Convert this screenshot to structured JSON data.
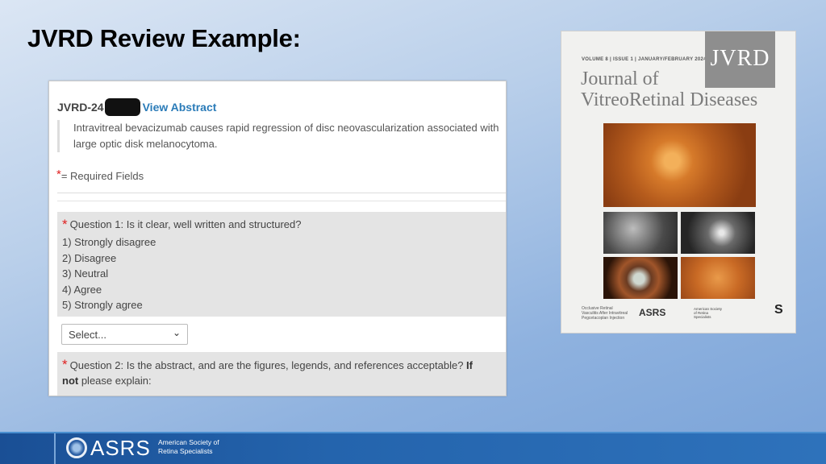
{
  "slide": {
    "title": "JVRD Review Example:"
  },
  "review_form": {
    "manuscript_id_prefix": "JVRD-24",
    "view_abstract_label": "View Abstract",
    "abstract_text": "Intravitreal bevacizumab causes rapid regression of disc neovascularization associated with large optic disk melanocytoma.",
    "required_star": "*",
    "required_label": "= Required Fields",
    "question1": {
      "star": "*",
      "text": "Question 1: Is it clear, well written and structured?",
      "options": [
        "1) Strongly disagree",
        "2) Disagree",
        "3) Neutral",
        "4) Agree",
        "5) Strongly agree"
      ]
    },
    "select_value": "Select...",
    "question2": {
      "star": "*",
      "text": "Question 2: Is the abstract, and are the figures, legends, and references acceptable? ",
      "bold_if": "If",
      "bold_not": "not",
      "tail": " please explain:"
    }
  },
  "journal_cover": {
    "issue_line": "VOLUME 8  |  ISSUE 1  |  JANUARY/FEBRUARY 2024",
    "badge": "JVRD",
    "name_line1": "Journal of",
    "name_line2": "VitreoRetinal Diseases",
    "footer_text": "Occlusive Retinal Vasculitis After Intravitreal Pegcetacoplan Injection",
    "footer_logo": "ASRS",
    "footer_sub": "American Society of Retina Specialists",
    "footer_s": "S"
  },
  "footer": {
    "logo_text": "ASRS",
    "org_line1": "American Society of",
    "org_line2": "Retina Specialists"
  },
  "icons": {
    "select_chevron": "chevron-down-icon"
  }
}
